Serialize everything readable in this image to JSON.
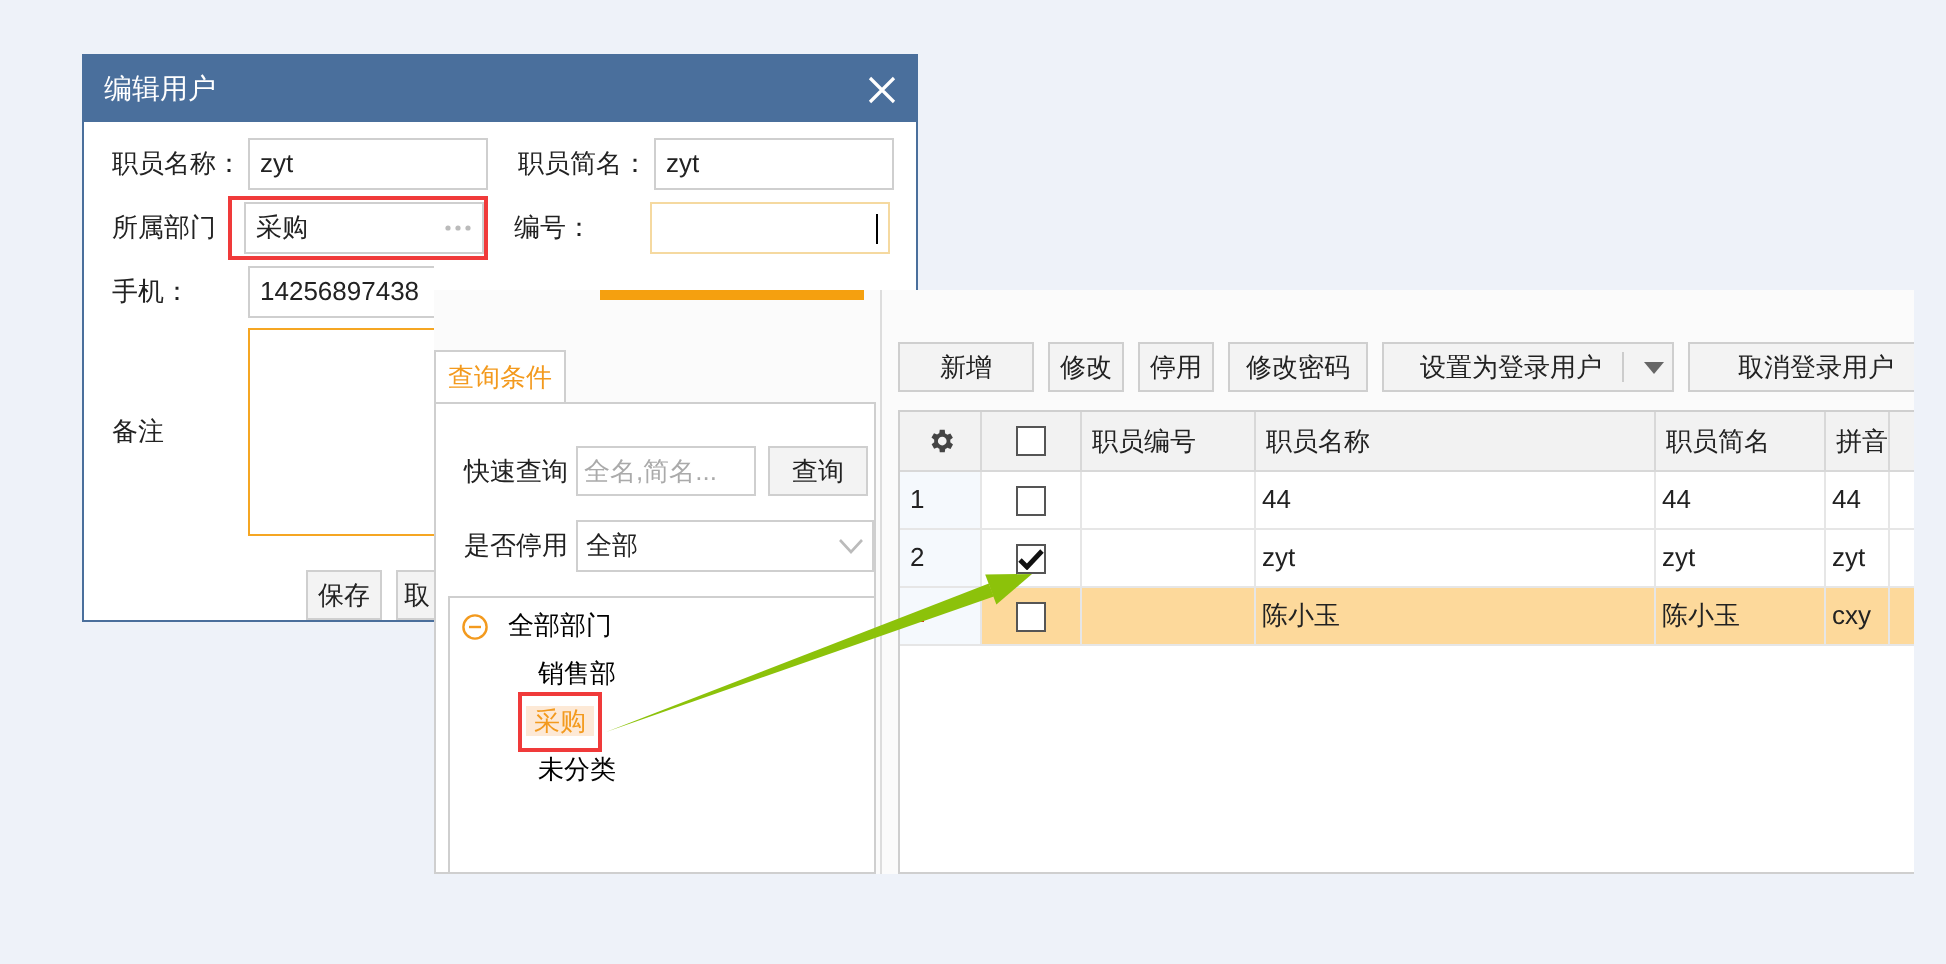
{
  "dialog": {
    "title": "编辑用户",
    "rows": [
      {
        "left": {
          "label": "职员名称：",
          "value": "zyt",
          "kind": "text"
        },
        "right": {
          "label": "职员简名：",
          "value": "zyt",
          "kind": "text"
        }
      },
      {
        "left": {
          "label": "所属部门",
          "value": "采购",
          "kind": "picker",
          "highlighted": true
        },
        "right": {
          "label": "编号：",
          "kind": "text",
          "focused": true
        }
      },
      {
        "left": {
          "label": "手机：",
          "value": "14256897438",
          "kind": "text",
          "clipped": true
        }
      }
    ],
    "notes": {
      "label": "备注",
      "focused": true
    },
    "buttons": [
      "保存",
      "取"
    ]
  },
  "panel": {
    "tab": {
      "label": "查询条件",
      "selected": true
    },
    "search": {
      "label": "快速查询",
      "placeholder": "全名,简名...",
      "button": "查询"
    },
    "filter": {
      "label": "是否停用",
      "value": "全部"
    },
    "tree": [
      {
        "label": "全部部门",
        "expanded": true,
        "selected": false,
        "children": [
          {
            "label": "销售部",
            "selected": false
          },
          {
            "label": "采购",
            "selected": true,
            "highlighted": true
          },
          {
            "label": "未分类",
            "selected": false
          }
        ]
      }
    ],
    "toolbar": [
      {
        "label": "新增",
        "kind": "button"
      },
      {
        "label": "修改",
        "kind": "button"
      },
      {
        "label": "停用",
        "kind": "button"
      },
      {
        "label": "修改密码",
        "kind": "button"
      },
      {
        "label": "设置为登录用户",
        "kind": "split"
      },
      {
        "label": "取消登录用户",
        "kind": "button"
      }
    ],
    "table": {
      "all_checked": false,
      "columns": [
        "职员编号",
        "职员名称",
        "职员简名",
        "拼音"
      ],
      "rows": [
        {
          "index": "1",
          "checked": false,
          "selected": false,
          "cells": [
            "",
            "44",
            "44",
            "44"
          ]
        },
        {
          "index": "2",
          "checked": true,
          "selected": false,
          "cells": [
            "",
            "zyt",
            "zyt",
            "zyt"
          ]
        },
        {
          "current": true,
          "checked": false,
          "selected": true,
          "cells": [
            "",
            "陈小玉",
            "陈小玉",
            "cxy"
          ]
        }
      ]
    }
  }
}
